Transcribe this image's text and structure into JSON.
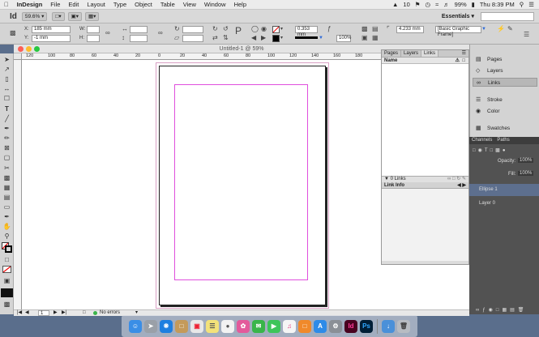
{
  "menubar": {
    "apple": "",
    "items": [
      "InDesign",
      "File",
      "Edit",
      "Layout",
      "Type",
      "Object",
      "Table",
      "View",
      "Window",
      "Help"
    ],
    "status": {
      "a_num": "10",
      "battery": "99%",
      "clock": "Thu 8:39 PM"
    }
  },
  "appbar": {
    "logo": "Id",
    "zoom": "59.6%",
    "workspace": "Essentials"
  },
  "control": {
    "x_label": "X:",
    "x_value": "185 mm",
    "y_label": "Y:",
    "y_value": "-1 mm",
    "w_label": "W:",
    "h_label": "H:",
    "stroke_value": "0.353 mm",
    "scale_value": "100%",
    "offset_value": "4.233 mm",
    "style_value": "[Basic Graphic Frame]"
  },
  "document": {
    "title": "Untitled-1 @ 59%",
    "ruler_labels": [
      "120",
      "100",
      "80",
      "60",
      "40",
      "20",
      "0",
      "20",
      "40",
      "60",
      "80",
      "100",
      "120",
      "140",
      "160",
      "180"
    ],
    "status_page": "1",
    "status_errors": "No errors"
  },
  "links_panel": {
    "tabs": [
      "Pages",
      "Layers",
      "Links"
    ],
    "active_tab": "Links",
    "column_name": "Name",
    "count": "0 Links",
    "info_title": "Link Info"
  },
  "dock": {
    "items": [
      {
        "label": "Pages",
        "icon": "pages-icon"
      },
      {
        "label": "Layers",
        "icon": "layers-icon"
      },
      {
        "label": "Links",
        "icon": "links-icon",
        "selected": true
      },
      {
        "label": "Stroke",
        "icon": "stroke-icon"
      },
      {
        "label": "Color",
        "icon": "color-icon"
      },
      {
        "label": "Swatches",
        "icon": "swatches-icon"
      }
    ]
  },
  "photoshop_panel": {
    "tabs": [
      "Channels",
      "Paths"
    ],
    "opacity_label": "Opacity:",
    "opacity_value": "100%",
    "fill_label": "Fill:",
    "fill_value": "100%",
    "layers": [
      {
        "name": "Ellipse 1",
        "selected": true
      },
      {
        "name": "Layer 0",
        "selected": false
      }
    ]
  },
  "macos_dock": {
    "indesign_label": "Id",
    "photoshop_label": "Ps"
  },
  "colors": {
    "accent": "#e04fdd",
    "indesign": "#49021f",
    "photoshop": "#001e36",
    "selection": "#5d6f8e"
  }
}
